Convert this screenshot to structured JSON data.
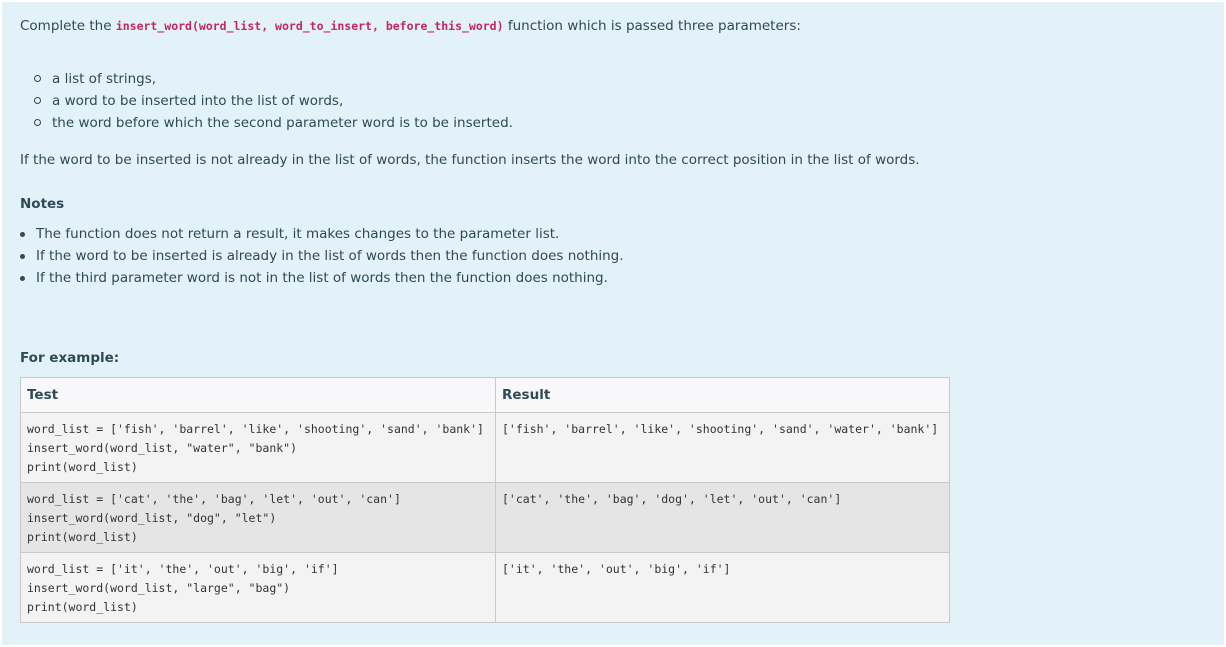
{
  "intro": {
    "before": "Complete the ",
    "signature": "insert_word(word_list, word_to_insert, before_this_word)",
    "after": " function which is passed three parameters:"
  },
  "params": [
    "a list of strings,",
    "a word to be inserted into the list of words,",
    "the word before which the second parameter word is to be inserted."
  ],
  "paragraph": "If the word to be inserted is not already in the list of words, the function inserts the word into the correct position in the list of words.",
  "notes": {
    "heading": "Notes",
    "items": [
      "The function does not return a result, it makes changes to the parameter list.",
      "If the word to be inserted is already in the list of words then the function does nothing.",
      "If the third parameter word is not in the list of words then the function does nothing."
    ]
  },
  "example": {
    "heading": "For example:",
    "columns": [
      "Test",
      "Result"
    ],
    "rows": [
      {
        "test": "word_list = ['fish', 'barrel', 'like', 'shooting', 'sand', 'bank']\ninsert_word(word_list, \"water\", \"bank\")\nprint(word_list)",
        "result": "['fish', 'barrel', 'like', 'shooting', 'sand', 'water', 'bank']"
      },
      {
        "test": "word_list = ['cat', 'the', 'bag', 'let', 'out', 'can']\ninsert_word(word_list, \"dog\", \"let\")\nprint(word_list)",
        "result": "['cat', 'the', 'bag', 'dog', 'let', 'out', 'can']"
      },
      {
        "test": "word_list = ['it', 'the', 'out', 'big', 'if']\ninsert_word(word_list, \"large\", \"bag\")\nprint(word_list)",
        "result": "['it', 'the', 'out', 'big', 'if']"
      }
    ]
  }
}
